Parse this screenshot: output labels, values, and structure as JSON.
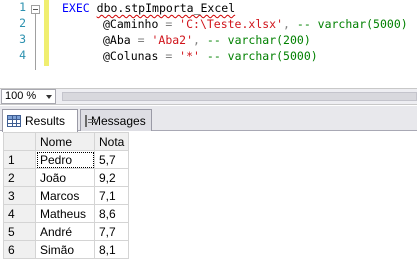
{
  "editor": {
    "line_numbers": [
      "1",
      "2",
      "3",
      "4"
    ],
    "lines": [
      {
        "kw": "EXEC",
        "proc": "dbo.stpImporta_Excel"
      },
      {
        "param": "@Caminho",
        "eq": " = ",
        "value": "'C:\\Teste.xlsx'",
        "sep": ", ",
        "comment": "-- varchar(5000)"
      },
      {
        "param": "@Aba",
        "eq": " = ",
        "value": "'Aba2'",
        "sep": ", ",
        "comment": "-- varchar(200)"
      },
      {
        "param": "@Colunas",
        "eq": " = ",
        "value": "'*'",
        "sep": " ",
        "comment": "-- varchar(5000)"
      }
    ]
  },
  "zoom": {
    "value": "100 %"
  },
  "tabs": [
    {
      "label": "Results",
      "icon": "grid-icon",
      "active": true
    },
    {
      "label": "Messages",
      "icon": "messages-icon",
      "active": false
    }
  ],
  "results": {
    "columns": [
      "Nome",
      "Nota"
    ],
    "rows": [
      {
        "n": "1",
        "nome": "Pedro",
        "nota": "5,7"
      },
      {
        "n": "2",
        "nome": "João",
        "nota": "9,2"
      },
      {
        "n": "3",
        "nome": "Marcos",
        "nota": "7,1"
      },
      {
        "n": "4",
        "nome": "Matheus",
        "nota": "8,6"
      },
      {
        "n": "5",
        "nome": "André",
        "nota": "7,7"
      },
      {
        "n": "6",
        "nome": "Simão",
        "nota": "8,1"
      }
    ]
  },
  "colors": {
    "keyword": "#0000ff",
    "string": "#d0141b",
    "comment": "#008000",
    "line_number": "#2b91af",
    "change_bar": "#f0ee70"
  }
}
